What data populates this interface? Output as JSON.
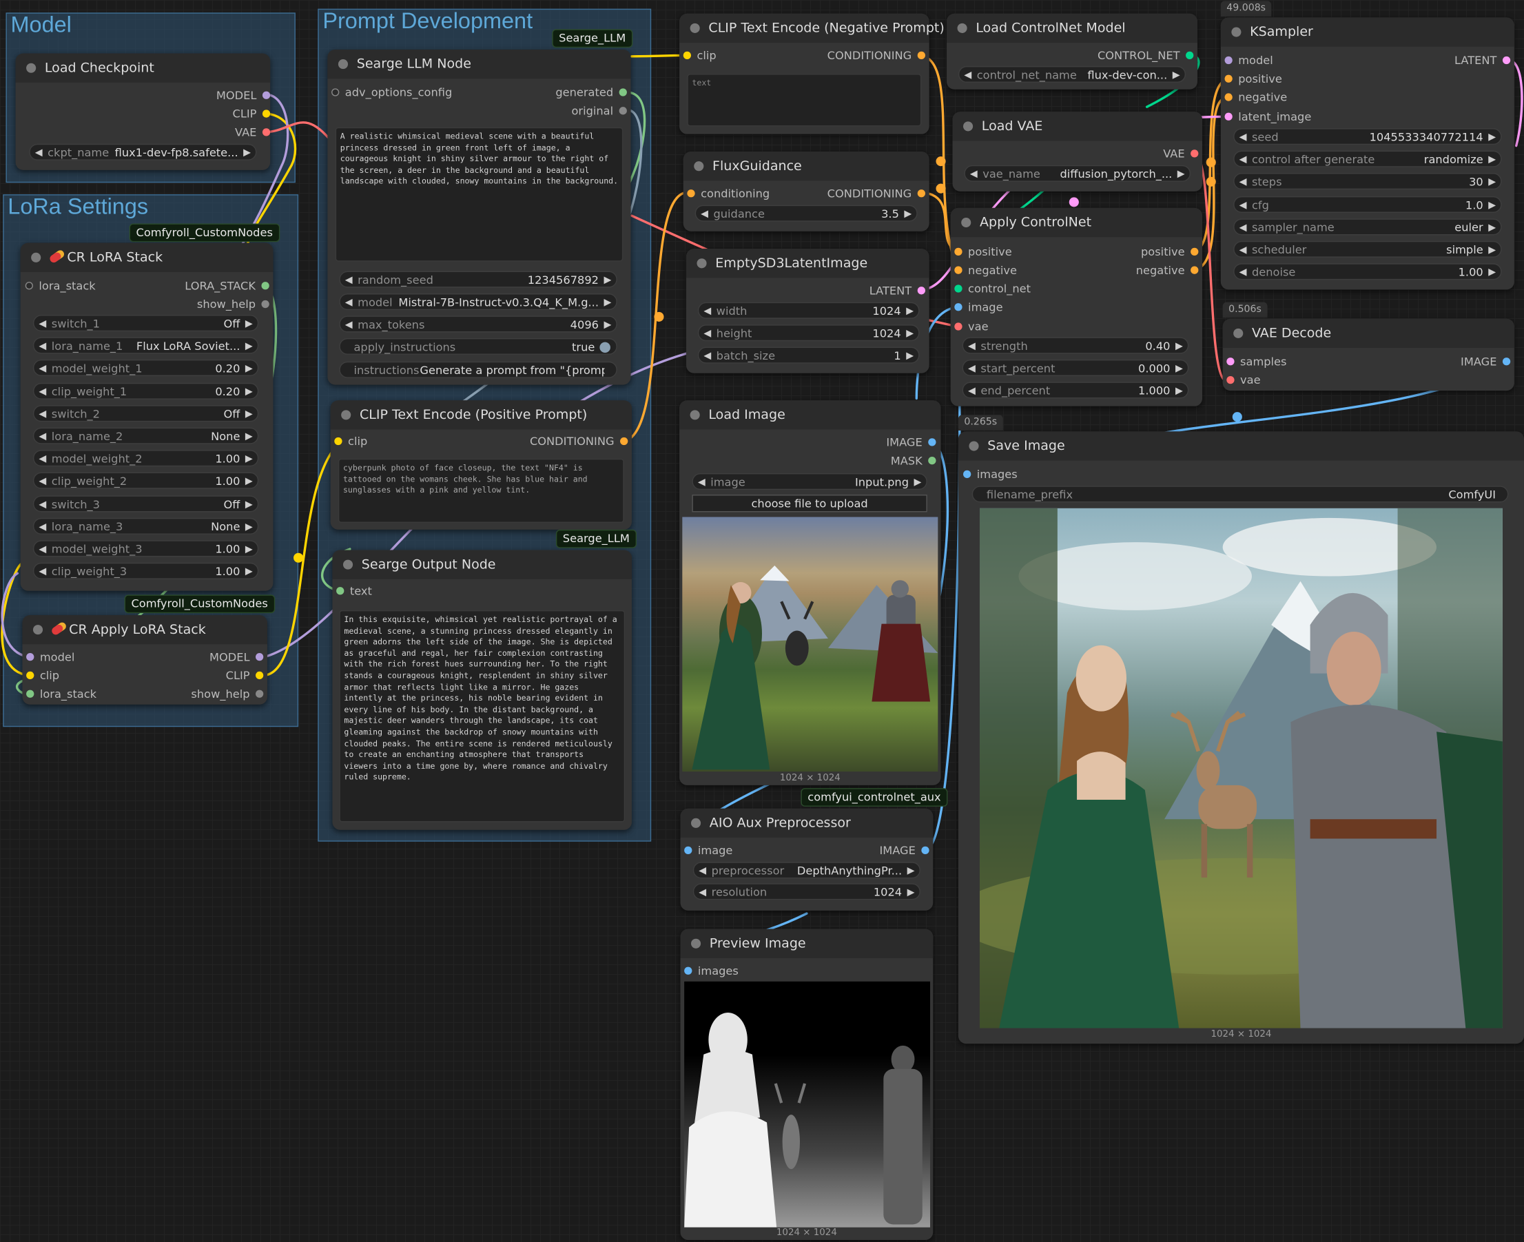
{
  "colors": {
    "model": "#b39ddb",
    "clip": "#ffd500",
    "vae": "#ff6e6e",
    "conditioning": "#ffa931",
    "latent": "#ff9cf9",
    "image": "#64b5f6",
    "mask": "#81c784",
    "control_net": "#00d78d",
    "lora_stack": "#81c784",
    "string": "#81c784",
    "any": "#aaaaaa"
  },
  "groups": {
    "model": "Model",
    "lora": "LoRa Settings",
    "prompt": "Prompt Development"
  },
  "badges": {
    "seargeLlm": "Searge_LLM",
    "comfyroll": "Comfyroll_CustomNodes",
    "controlnetAux": "comfyui_controlnet_aux"
  },
  "times": {
    "ksampler": "49.008s",
    "vaeDecode": "0.506s",
    "saveImage": "0.265s"
  },
  "nodes": {
    "loadCheckpoint": {
      "title": "Load Checkpoint",
      "out_model": "MODEL",
      "out_clip": "CLIP",
      "out_vae": "VAE",
      "ckpt_label": "ckpt_name",
      "ckpt_value": "flux1-dev-fp8.safete..."
    },
    "crLoraStack": {
      "title": "CR LoRA Stack",
      "in_lora_stack": "lora_stack",
      "out_lora_stack": "LORA_STACK",
      "out_show_help": "show_help",
      "widgets": [
        {
          "label": "switch_1",
          "value": "Off"
        },
        {
          "label": "lora_name_1",
          "value": "Flux LoRA Soviet..."
        },
        {
          "label": "model_weight_1",
          "value": "0.20"
        },
        {
          "label": "clip_weight_1",
          "value": "0.20"
        },
        {
          "label": "switch_2",
          "value": "Off"
        },
        {
          "label": "lora_name_2",
          "value": "None"
        },
        {
          "label": "model_weight_2",
          "value": "1.00"
        },
        {
          "label": "clip_weight_2",
          "value": "1.00"
        },
        {
          "label": "switch_3",
          "value": "Off"
        },
        {
          "label": "lora_name_3",
          "value": "None"
        },
        {
          "label": "model_weight_3",
          "value": "1.00"
        },
        {
          "label": "clip_weight_3",
          "value": "1.00"
        }
      ]
    },
    "crApplyLora": {
      "title": "CR Apply LoRA Stack",
      "in_model": "model",
      "in_clip": "clip",
      "in_lora_stack": "lora_stack",
      "out_model": "MODEL",
      "out_clip": "CLIP",
      "out_show_help": "show_help"
    },
    "seargeLlm": {
      "title": "Searge LLM Node",
      "in_adv": "adv_options_config",
      "out_generated": "generated",
      "out_original": "original",
      "text": "A realistic whimsical medieval scene with a beautiful princess dressed in green front left of image, a courageous knight in shiny silver armour to the right of the screen, a deer in the background and a beautiful landscape with clouded, snowy mountains in the background.",
      "widgets": [
        {
          "label": "random_seed",
          "value": "1234567892"
        },
        {
          "label": "model",
          "value": "Mistral-7B-Instruct-v0.3.Q4_K_M.g..."
        },
        {
          "label": "max_tokens",
          "value": "4096"
        }
      ],
      "apply_label": "apply_instructions",
      "apply_value": "true",
      "instr_label": "instructions",
      "instr_value": "Generate a prompt from \"{promp"
    },
    "clipPositive": {
      "title": "CLIP Text Encode (Positive Prompt)",
      "in_clip": "clip",
      "out_cond": "CONDITIONING",
      "text": "cyberpunk photo of face closeup, the text \"NF4\" is tattooed on the womans cheek. She has blue hair and sunglasses with a pink and yellow tint."
    },
    "seargeOutput": {
      "title": "Searge Output Node",
      "in_text": "text",
      "text": "In this exquisite, whimsical yet realistic portrayal of a medieval scene, a stunning princess dressed elegantly in green adorns the left side of the image. She is depicted as graceful and regal, her fair complexion contrasting with the rich forest hues surrounding her. To the right stands a courageous knight, resplendent in shiny silver armor that reflects light like a mirror. He gazes intently at the princess, his noble bearing evident in every line of his body. In the distant background, a majestic deer wanders through the landscape, its coat gleaming against the backdrop of snowy mountains with clouded peaks. The entire scene is rendered meticulously to create an enchanting atmosphere that transports viewers into a time gone by, where romance and chivalry ruled supreme."
    },
    "clipNegative": {
      "title": "CLIP Text Encode (Negative Prompt)",
      "in_clip": "clip",
      "out_cond": "CONDITIONING",
      "placeholder": "text"
    },
    "fluxGuidance": {
      "title": "FluxGuidance",
      "in_cond": "conditioning",
      "out_cond": "CONDITIONING",
      "label": "guidance",
      "value": "3.5"
    },
    "emptyLatent": {
      "title": "EmptySD3LatentImage",
      "out_latent": "LATENT",
      "widgets": [
        {
          "label": "width",
          "value": "1024"
        },
        {
          "label": "height",
          "value": "1024"
        },
        {
          "label": "batch_size",
          "value": "1"
        }
      ]
    },
    "loadImage": {
      "title": "Load Image",
      "out_image": "IMAGE",
      "out_mask": "MASK",
      "label": "image",
      "value": "Input.png",
      "upload": "choose file to upload",
      "caption": "1024 × 1024"
    },
    "aio": {
      "title": "AIO Aux Preprocessor",
      "in_image": "image",
      "out_image": "IMAGE",
      "widgets": [
        {
          "label": "preprocessor",
          "value": "DepthAnythingPr..."
        },
        {
          "label": "resolution",
          "value": "1024"
        }
      ]
    },
    "preview": {
      "title": "Preview Image",
      "in_images": "images",
      "caption": "1024 × 1024"
    },
    "loadControlNet": {
      "title": "Load ControlNet Model",
      "out": "CONTROL_NET",
      "label": "control_net_name",
      "value": "flux-dev-con..."
    },
    "loadVae": {
      "title": "Load VAE",
      "out": "VAE",
      "label": "vae_name",
      "value": "diffusion_pytorch_..."
    },
    "applyControlNet": {
      "title": "Apply ControlNet",
      "in_positive": "positive",
      "in_negative": "negative",
      "in_control_net": "control_net",
      "in_image": "image",
      "in_vae": "vae",
      "out_positive": "positive",
      "out_negative": "negative",
      "widgets": [
        {
          "label": "strength",
          "value": "0.40"
        },
        {
          "label": "start_percent",
          "value": "0.000"
        },
        {
          "label": "end_percent",
          "value": "1.000"
        }
      ]
    },
    "ksampler": {
      "title": "KSampler",
      "in_model": "model",
      "in_positive": "positive",
      "in_negative": "negative",
      "in_latent": "latent_image",
      "out_latent": "LATENT",
      "widgets": [
        {
          "label": "seed",
          "value": "1045533340772114"
        },
        {
          "label": "control after generate",
          "value": "randomize"
        },
        {
          "label": "steps",
          "value": "30"
        },
        {
          "label": "cfg",
          "value": "1.0"
        },
        {
          "label": "sampler_name",
          "value": "euler"
        },
        {
          "label": "scheduler",
          "value": "simple"
        },
        {
          "label": "denoise",
          "value": "1.00"
        }
      ]
    },
    "vaeDecode": {
      "title": "VAE Decode",
      "in_samples": "samples",
      "in_vae": "vae",
      "out_image": "IMAGE"
    },
    "saveImage": {
      "title": "Save Image",
      "in_images": "images",
      "label": "filename_prefix",
      "value": "ComfyUI",
      "caption": "1024 × 1024"
    }
  }
}
